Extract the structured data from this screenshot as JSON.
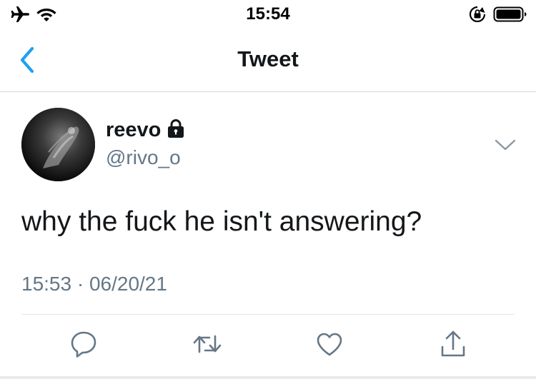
{
  "status_bar": {
    "time": "15:54",
    "icons": [
      "airplane-icon",
      "wifi-icon",
      "orientation-lock-icon",
      "battery-icon"
    ]
  },
  "nav": {
    "title": "Tweet",
    "back_icon": "chevron-left-icon"
  },
  "tweet": {
    "author": {
      "display_name": "reevo",
      "handle": "@rivo_o",
      "protected_icon": "lock-icon"
    },
    "text": "why the fuck he isn't answering?",
    "timestamp": "15:53 · 06/20/21",
    "menu_icon": "chevron-down-icon",
    "actions": [
      "reply-icon",
      "retweet-icon",
      "like-icon",
      "share-icon"
    ]
  },
  "colors": {
    "accent": "#1da1f2",
    "text_primary": "#14171a",
    "text_secondary": "#657786",
    "divider": "#e1e8ed"
  }
}
